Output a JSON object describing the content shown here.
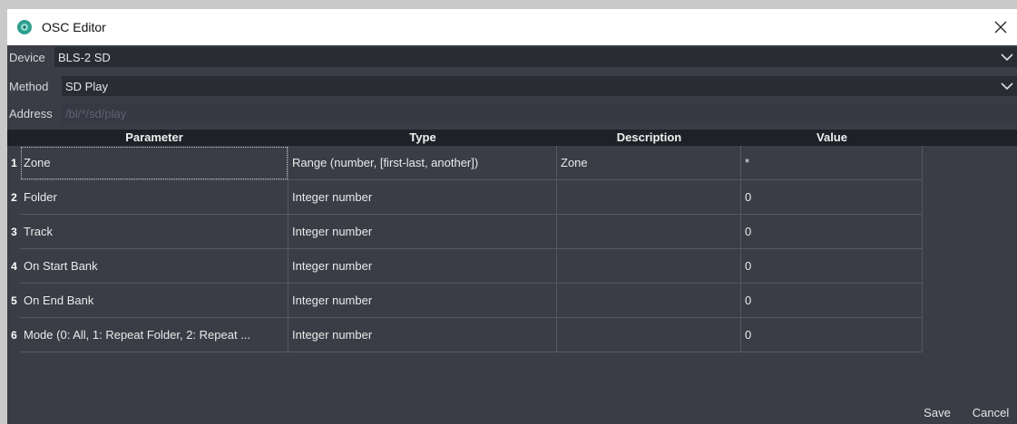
{
  "window": {
    "title": "OSC Editor"
  },
  "fields": {
    "device": {
      "label": "Device",
      "value": "BLS-2 SD"
    },
    "method": {
      "label": "Method",
      "value": "SD Play"
    },
    "address": {
      "label": "Address",
      "value": "/bl/*/sd/play"
    }
  },
  "table": {
    "headers": {
      "parameter": "Parameter",
      "type": "Type",
      "description": "Description",
      "value": "Value"
    },
    "rows": [
      {
        "num": "1",
        "parameter": "Zone",
        "type": "Range (number, [first-last, another])",
        "description": "Zone",
        "value": "*"
      },
      {
        "num": "2",
        "parameter": "Folder",
        "type": "Integer number",
        "description": "",
        "value": "0"
      },
      {
        "num": "3",
        "parameter": "Track",
        "type": "Integer number",
        "description": "",
        "value": "0"
      },
      {
        "num": "4",
        "parameter": "On Start Bank",
        "type": "Integer number",
        "description": "",
        "value": "0"
      },
      {
        "num": "5",
        "parameter": "On End Bank",
        "type": "Integer number",
        "description": "",
        "value": "0"
      },
      {
        "num": "6",
        "parameter": "Mode (0: All, 1: Repeat Folder, 2: Repeat ...",
        "type": "Integer number",
        "description": "",
        "value": "0"
      }
    ]
  },
  "buttons": {
    "save": "Save",
    "cancel": "Cancel"
  },
  "colors": {
    "background": "#3a3d46",
    "header": "#1f2128",
    "titlebar": "#ffffff"
  }
}
